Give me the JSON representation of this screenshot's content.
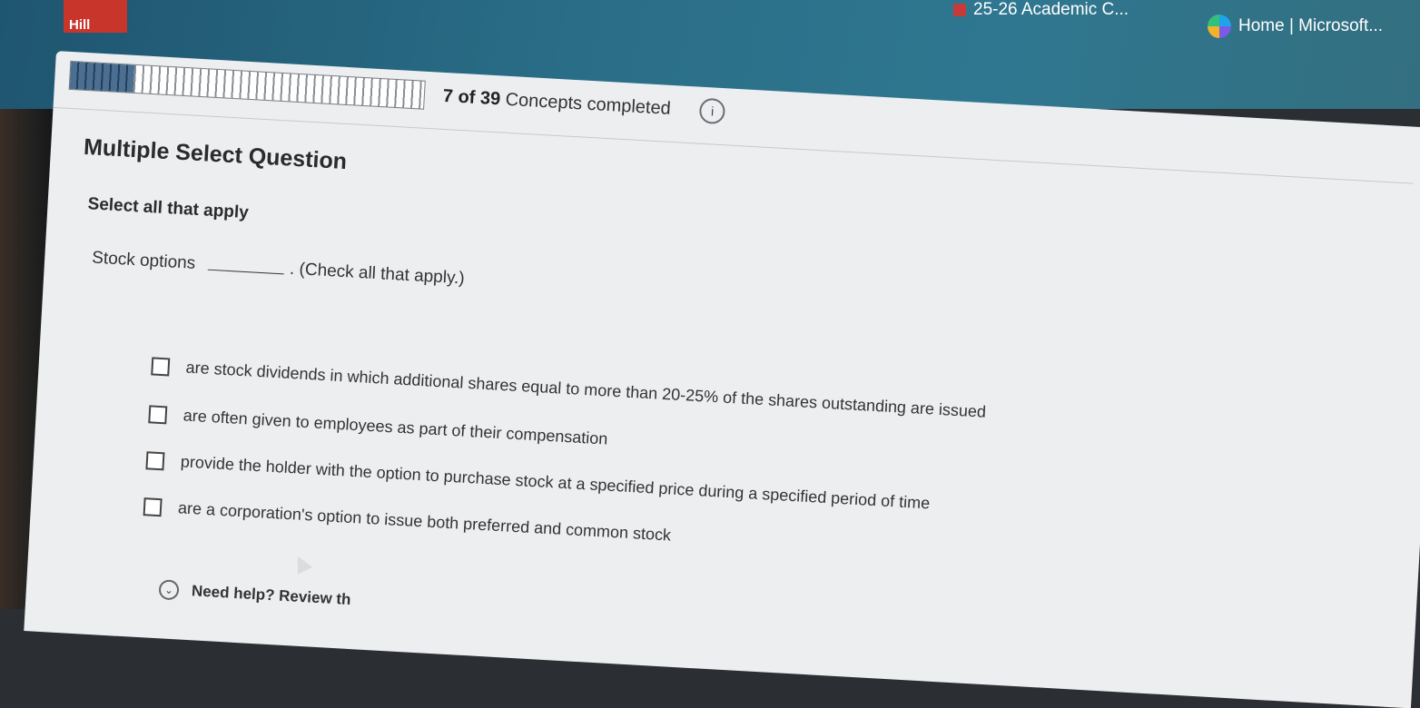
{
  "bookmarks": {
    "logo_text": "Hill",
    "item1": "25-26 Academic C...",
    "item2": "Home | Microsoft..."
  },
  "progress": {
    "completed": "7",
    "total": "39",
    "label": "Concepts completed",
    "fraction": 0.18
  },
  "question": {
    "type_label": "Multiple Select Question",
    "instruction": "Select all that apply",
    "stem_start": "Stock options",
    "stem_end": ". (Check all that apply.)",
    "options": [
      "are stock dividends in which additional shares equal to more than 20-25% of the shares outstanding are issued",
      "are often given to employees as part of their compensation",
      "provide the holder with the option to purchase stock at a specified price during a specified period of time",
      "are a corporation's option to issue both preferred and common stock"
    ]
  },
  "help": {
    "label": "Need help? Review th"
  },
  "colors": {
    "progress_fill": "#22405c",
    "brand_red": "#c8362b",
    "bookmark_bar": "#2a6d86"
  }
}
